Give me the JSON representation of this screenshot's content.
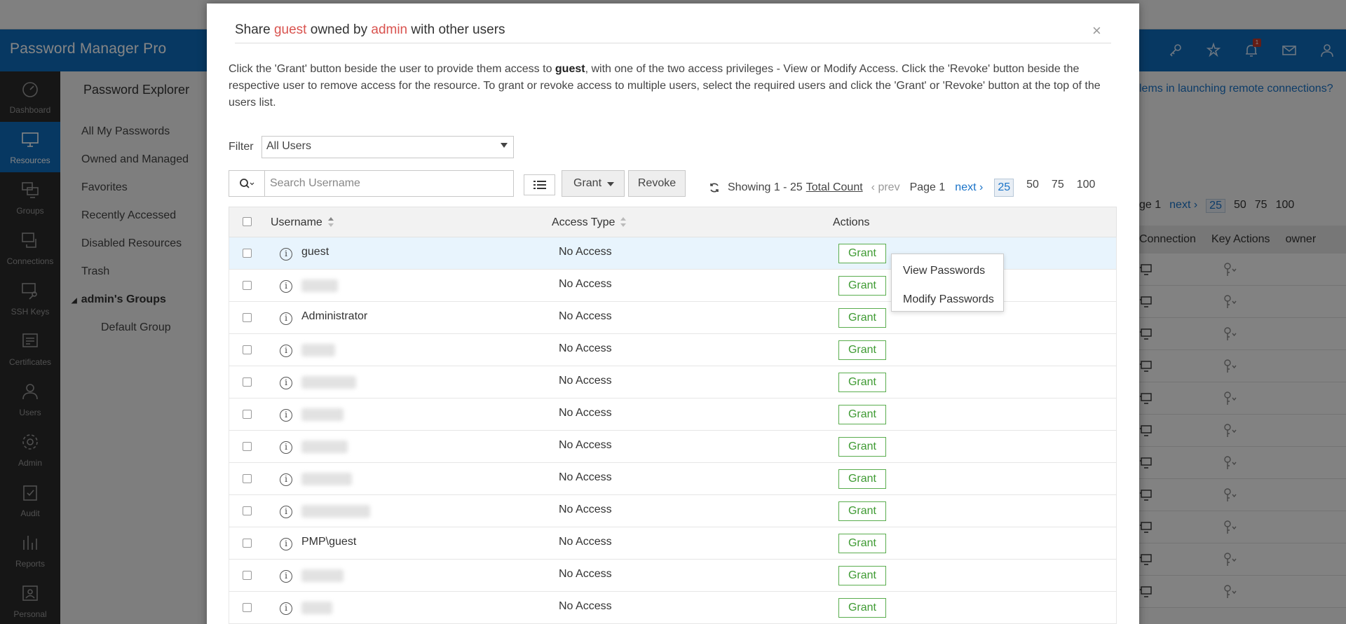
{
  "app": {
    "brand": "Password Manager Pro",
    "notification_count": "1"
  },
  "sidebar": {
    "items": [
      {
        "label": "Dashboard",
        "icon": "dashboard-icon"
      },
      {
        "label": "Resources",
        "icon": "monitor-icon",
        "active": true
      },
      {
        "label": "Groups",
        "icon": "groups-icon"
      },
      {
        "label": "Connections",
        "icon": "connections-icon"
      },
      {
        "label": "SSH Keys",
        "icon": "ssh-key-icon"
      },
      {
        "label": "Certificates",
        "icon": "certificate-icon"
      },
      {
        "label": "Users",
        "icon": "user-icon"
      },
      {
        "label": "Admin",
        "icon": "gear-icon"
      },
      {
        "label": "Audit",
        "icon": "clipboard-check-icon"
      },
      {
        "label": "Reports",
        "icon": "bar-chart-icon"
      },
      {
        "label": "Personal",
        "icon": "contact-card-icon"
      }
    ]
  },
  "explorer": {
    "title": "Password Explorer",
    "items": [
      "All My Passwords",
      "Owned and Managed",
      "Favorites",
      "Recently Accessed",
      "Disabled Resources",
      "Trash"
    ],
    "group_title": "admin's Groups",
    "group_items": [
      "Default Group"
    ]
  },
  "background": {
    "help_link": "lems in launching remote connections?",
    "pager": {
      "page": "ge 1",
      "next": "next",
      "sizes": [
        "25",
        "50",
        "75",
        "100"
      ],
      "selected_size": "25"
    },
    "columns": [
      "Connection",
      "Key Actions",
      "owner"
    ]
  },
  "modal": {
    "title_prefix": "Share ",
    "title_resource": "guest",
    "title_mid": " owned by ",
    "title_owner": "admin",
    "title_suffix": " with other users",
    "close_label": "×",
    "instructions_before": "Click the 'Grant' button beside the user to provide them access to ",
    "instructions_resource": "guest",
    "instructions_after": ", with one of the two access privileges - View or Modify Access. Click the 'Revoke' button beside the respective user to remove access for the resource. To grant or revoke access to multiple users, select the required users and click the 'Grant' or 'Revoke' button at the top of the users list.",
    "filter": {
      "label": "Filter",
      "value": "All Users"
    },
    "search": {
      "placeholder": "Search Username"
    },
    "toolbar": {
      "grant_label": "Grant",
      "revoke_label": "Revoke"
    },
    "pager": {
      "showing": "Showing 1 - 25",
      "total_count": "Total Count",
      "prev": "prev",
      "page": "Page 1",
      "next": "next",
      "sizes": [
        "25",
        "50",
        "75",
        "100"
      ],
      "selected_size": "25"
    },
    "table": {
      "headers": {
        "username": "Username",
        "access_type": "Access Type",
        "actions": "Actions"
      },
      "grant_label": "Grant",
      "rows": [
        {
          "username": "guest",
          "access": "No Access",
          "highlighted": true
        },
        {
          "username": "",
          "blur_width": 52,
          "access": "No Access"
        },
        {
          "username": "Administrator",
          "access": "No Access"
        },
        {
          "username": "",
          "blur_width": 48,
          "access": "No Access"
        },
        {
          "username": "",
          "blur_width": 78,
          "access": "No Access"
        },
        {
          "username": "",
          "blur_width": 60,
          "access": "No Access"
        },
        {
          "username": "",
          "blur_width": 66,
          "access": "No Access"
        },
        {
          "username": "",
          "blur_width": 72,
          "access": "No Access"
        },
        {
          "username": "",
          "blur_width": 98,
          "access": "No Access"
        },
        {
          "username": "PMP\\guest",
          "access": "No Access"
        },
        {
          "username": "",
          "blur_width": 60,
          "access": "No Access"
        },
        {
          "username": "",
          "blur_width": 44,
          "access": "No Access"
        }
      ]
    },
    "grant_menu": {
      "view": "View Passwords",
      "modify": "Modify Passwords"
    }
  }
}
